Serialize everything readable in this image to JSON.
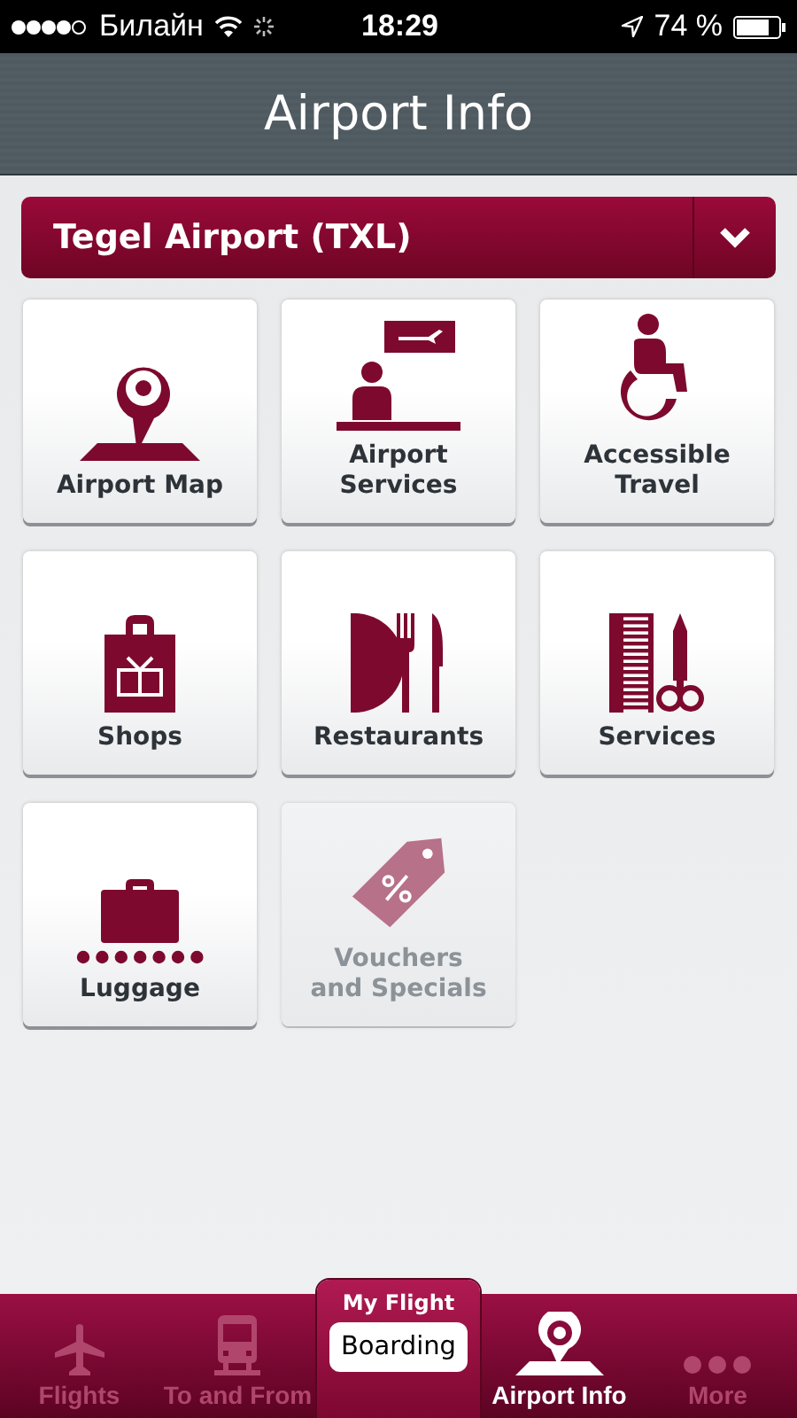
{
  "status_bar": {
    "carrier": "Билайн",
    "time": "18:29",
    "battery": "74 %"
  },
  "nav_bar": {
    "title": "Airport Info"
  },
  "airport_picker": {
    "value": "Tegel Airport (TXL)"
  },
  "tiles": [
    {
      "kind": "map",
      "label": [
        "Airport Map"
      ],
      "disabled": false
    },
    {
      "kind": "desk",
      "label": [
        "Airport",
        "Services"
      ],
      "disabled": false
    },
    {
      "kind": "wheelchair",
      "label": [
        "Accessible",
        "Travel"
      ],
      "disabled": false
    },
    {
      "kind": "bag",
      "label": [
        "Shops"
      ],
      "disabled": false
    },
    {
      "kind": "cutlery",
      "label": [
        "Restaurants"
      ],
      "disabled": false
    },
    {
      "kind": "comb",
      "label": [
        "Services"
      ],
      "disabled": false
    },
    {
      "kind": "luggage",
      "label": [
        "Luggage"
      ],
      "disabled": false
    },
    {
      "kind": "tag",
      "label": [
        "Vouchers",
        "and Specials"
      ],
      "disabled": true
    }
  ],
  "tab_bar": [
    {
      "kind": "plane",
      "label": "Flights",
      "selected": false
    },
    {
      "kind": "train",
      "label": "To and From",
      "selected": false
    },
    {
      "kind": "center",
      "label": "My Flight",
      "badge": "Boarding",
      "selected": false
    },
    {
      "kind": "map",
      "label": "Airport Info",
      "selected": true
    },
    {
      "kind": "dots",
      "label": "More",
      "selected": false
    }
  ]
}
